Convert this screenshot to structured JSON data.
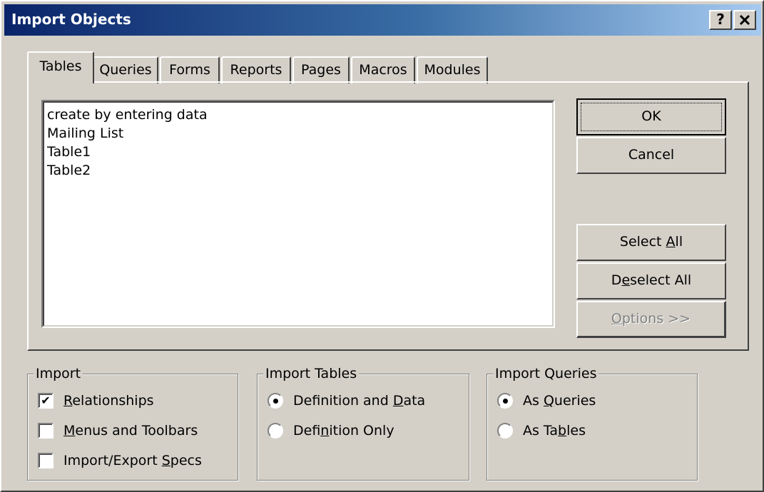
{
  "window": {
    "title": "Import Objects",
    "help_glyph": "?",
    "close_glyph": "✕"
  },
  "tabs": [
    {
      "label": "Tables"
    },
    {
      "label": "Queries"
    },
    {
      "label": "Forms"
    },
    {
      "label": "Reports"
    },
    {
      "label": "Pages"
    },
    {
      "label": "Macros"
    },
    {
      "label": "Modules"
    }
  ],
  "list": {
    "items": [
      "create by entering data",
      "Mailing List",
      "Table1",
      "Table2"
    ]
  },
  "buttons": {
    "ok": "OK",
    "cancel": "Cancel",
    "select_all_pre": "Select ",
    "select_all_acc": "A",
    "select_all_post": "ll",
    "deselect_all_pre": "D",
    "deselect_all_acc": "e",
    "deselect_all_post": "select All",
    "options_acc": "O",
    "options_post": "ptions >>"
  },
  "import_group": {
    "legend": "Import",
    "relationships_acc": "R",
    "relationships_post": "elationships",
    "relationships_checked": true,
    "menus_acc": "M",
    "menus_post": "enus and Toolbars",
    "menus_checked": false,
    "specs_pre": "Import/Export ",
    "specs_acc": "S",
    "specs_post": "pecs",
    "specs_checked": false
  },
  "import_tables_group": {
    "legend": "Import Tables",
    "def_data_pre": "Definition and ",
    "def_data_acc": "D",
    "def_data_post": "ata",
    "def_only_pre": "Defi",
    "def_only_acc": "n",
    "def_only_post": "ition Only",
    "selected": "Definition and Data"
  },
  "import_queries_group": {
    "legend": "Import Queries",
    "as_queries_pre": "As ",
    "as_queries_acc": "Q",
    "as_queries_post": "ueries",
    "as_tables_pre": "As Ta",
    "as_tables_acc": "b",
    "as_tables_post": "les",
    "selected": "As Queries"
  },
  "colors": {
    "face": "#d4d0c8",
    "title_start": "#0a246a",
    "title_end": "#a6caf0"
  }
}
